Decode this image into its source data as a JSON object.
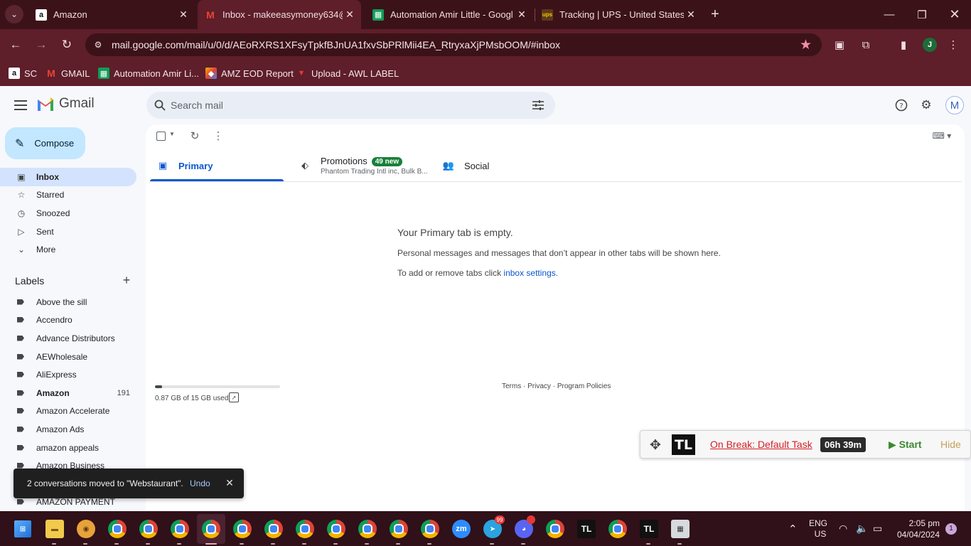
{
  "browser": {
    "tabs": [
      {
        "title": "Amazon",
        "icon": "amazon-icon",
        "active": false
      },
      {
        "title": "Inbox - makeeasymoney634@g",
        "icon": "gmail-icon",
        "active": true
      },
      {
        "title": "Automation Amir Little - Googl",
        "icon": "sheets-icon",
        "active": false
      },
      {
        "title": "Tracking | UPS - United States",
        "icon": "ups-icon",
        "active": false
      }
    ],
    "url": "mail.google.com/mail/u/0/d/AEoRXRS1XFsyTpkfBJnUA1fxvSbPRlMii4EA_RtryxaXjPMsbOOM/#inbox",
    "profile_initial": "J",
    "bookmarks": [
      {
        "label": "SC",
        "icon": "amazon-icon"
      },
      {
        "label": "GMAIL",
        "icon": "gmail-icon"
      },
      {
        "label": "Automation Amir Li...",
        "icon": "sheets-icon"
      },
      {
        "label": "AMZ EOD Report",
        "icon": "report-icon"
      },
      {
        "label": "Upload - AWL LABEL",
        "icon": "label-icon"
      }
    ]
  },
  "gmail": {
    "logo_text": "Gmail",
    "search_placeholder": "Search mail",
    "account_initial": "M",
    "compose_label": "Compose",
    "nav": [
      {
        "label": "Inbox",
        "icon": "inbox-icon",
        "active": true
      },
      {
        "label": "Starred",
        "icon": "star-icon",
        "active": false
      },
      {
        "label": "Snoozed",
        "icon": "clock-icon",
        "active": false
      },
      {
        "label": "Sent",
        "icon": "send-icon",
        "active": false
      },
      {
        "label": "More",
        "icon": "chevron-down-icon",
        "active": false
      }
    ],
    "labels_header": "Labels",
    "labels": [
      {
        "name": "Above the sill",
        "count": ""
      },
      {
        "name": "Accendro",
        "count": ""
      },
      {
        "name": "Advance Distributors",
        "count": ""
      },
      {
        "name": "AEWholesale",
        "count": ""
      },
      {
        "name": "AliExpress",
        "count": ""
      },
      {
        "name": "Amazon",
        "count": "191",
        "bold": true
      },
      {
        "name": "Amazon Accelerate",
        "count": ""
      },
      {
        "name": "Amazon Ads",
        "count": ""
      },
      {
        "name": "amazon appeals",
        "count": ""
      },
      {
        "name": "Amazon Business",
        "count": ""
      },
      {
        "name": "AMAZON PAYMENT",
        "count": ""
      }
    ],
    "category_tabs": {
      "primary": "Primary",
      "promotions": "Promotions",
      "promotions_badge": "49 new",
      "promotions_sub": "Phantom Trading Intl inc, Bulk B...",
      "social": "Social"
    },
    "empty": {
      "title": "Your Primary tab is empty.",
      "description": "Personal messages and messages that don’t appear in other tabs will be shown here.",
      "hint_prefix": "To add or remove tabs click ",
      "hint_link": "inbox settings",
      "hint_suffix": "."
    },
    "storage": {
      "text": "0.87 GB of 15 GB used",
      "fraction": 0.058
    },
    "footer": {
      "terms": "Terms",
      "privacy": "Privacy",
      "policies": "Program Policies",
      "sep": " · "
    },
    "toast": {
      "message": "2 conversations moved to \"Webstaurant\".",
      "undo": "Undo"
    }
  },
  "timelogger": {
    "logo": "TL",
    "status": "On Break: Default Task",
    "timer": "06h 39m",
    "start_label": "▶ Start",
    "hide_label": "Hide"
  },
  "taskbar": {
    "time": "2:05 pm",
    "date": "04/04/2024",
    "lang_top": "ENG",
    "lang_bottom": "US",
    "notification_count": "1",
    "zoom_label": "zm",
    "telegram_badge": "99",
    "tl_label": "TL"
  }
}
